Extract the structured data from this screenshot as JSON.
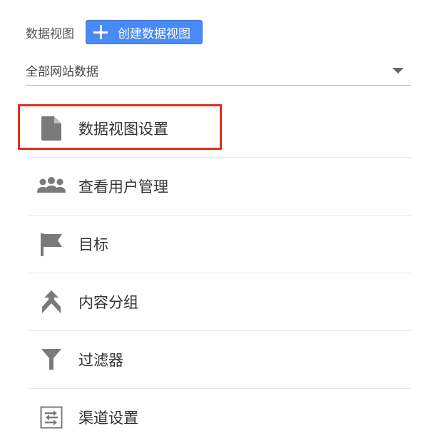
{
  "header": {
    "label": "数据视图",
    "create_button_label": "创建数据视图"
  },
  "view_select": {
    "value": "全部网站数据"
  },
  "menu": {
    "items": [
      {
        "label": "数据视图设置",
        "icon": "document-icon",
        "selected": true
      },
      {
        "label": "查看用户管理",
        "icon": "users-icon"
      },
      {
        "label": "目标",
        "icon": "flag-icon"
      },
      {
        "label": "内容分组",
        "icon": "merge-icon"
      },
      {
        "label": "过滤器",
        "icon": "filter-icon"
      },
      {
        "label": "渠道设置",
        "icon": "channel-settings-icon"
      }
    ]
  },
  "colors": {
    "accent": "#4a8af4",
    "highlight_border": "#e0301e",
    "icon_gray": "#7a7a7a"
  }
}
